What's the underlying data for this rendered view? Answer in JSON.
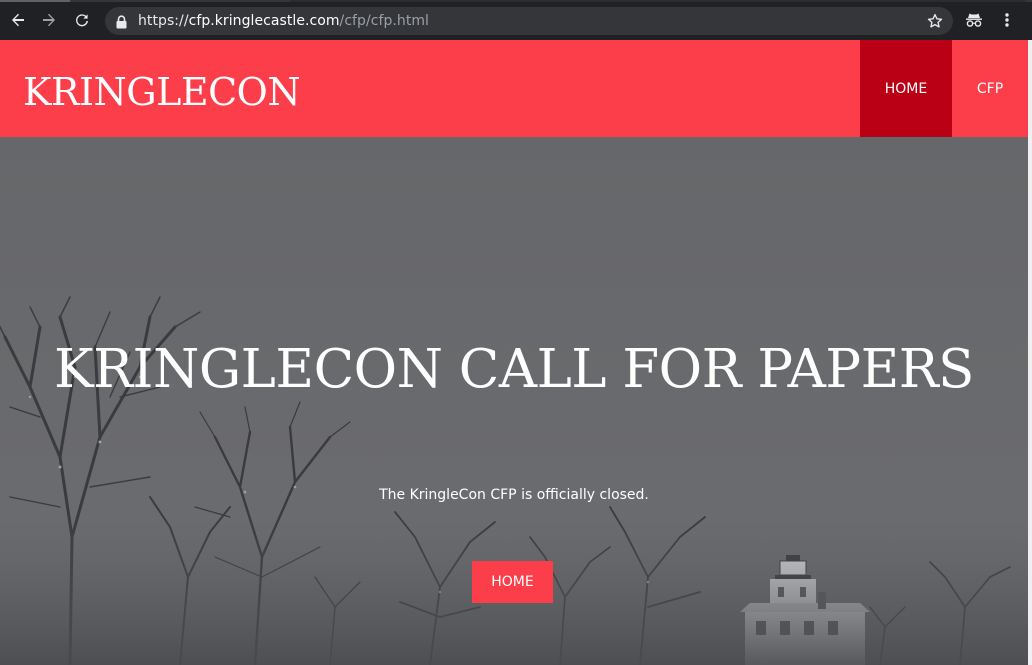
{
  "browser": {
    "url_scheme": "https://",
    "url_host": "cfp.kringlecastle.com",
    "url_path": "/cfp/cfp.html",
    "icons": [
      "back-arrow-icon",
      "forward-arrow-icon",
      "reload-icon",
      "lock-icon",
      "bookmark-star-icon",
      "incognito-icon",
      "more-vert-icon"
    ]
  },
  "site": {
    "brand": "KRINGLECON",
    "menu": [
      {
        "label": "HOME",
        "active": true
      },
      {
        "label": "CFP",
        "active": false
      }
    ]
  },
  "hero": {
    "title": "KRINGLECON CALL FOR PAPERS",
    "subtitle": "The KringleCon CFP is officially closed.",
    "button_label": "HOME"
  },
  "colors": {
    "header_bg": "#fc3e4b",
    "active_menu_bg": "#b90015",
    "button_bg": "#fc3e4b",
    "hero_overlay": "#696a6d"
  }
}
